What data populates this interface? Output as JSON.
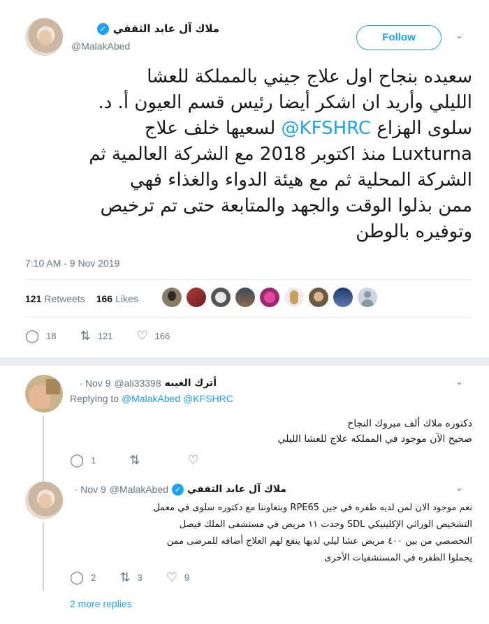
{
  "main_tweet": {
    "display_name": "ملاك آل عابد الثقفي",
    "handle": "@MalakAbed",
    "follow_label": "Follow",
    "text_lines": [
      "سعيده بنجاح اول علاج جيني بالمملكة للعشا",
      "الليلي وأريد ان اشكر أيضا رئيس قسم العيون  أ. د.",
      "سلوى الهزاع",
      "@KFSHRC",
      "لسعيها خلف علاج",
      "Luxturna منذ اكتوبر 2018 مع الشركة العالمية ثم",
      "الشركة المحلية ثم مع هيئة الدواء والغذاء فهي",
      "ممن بذلوا الوقت والجهد والمتابعة حتى تم ترخيص",
      "وتوفيره بالوطن"
    ],
    "timestamp": "7:10 AM - 9 Nov 2019",
    "retweets_count": "121",
    "retweets_label": "Retweets",
    "likes_count": "166",
    "likes_label": "Likes",
    "action_counts": {
      "reply": "18",
      "retweet": "121",
      "like": "166"
    }
  },
  "replies": [
    {
      "display_name": "أترك الغيبه",
      "handle": "@ali33398",
      "date": "Nov 9",
      "replying_prefix": "Replying to",
      "replying_to": "@MalakAbed @KFSHRC",
      "text_lines": [
        "دكتوره ملاك ألف مبروك النجاح",
        "صحيح الآن موجود في المملكه علاج للعشا الليلي"
      ],
      "counts": {
        "reply": "1",
        "retweet": "",
        "like": ""
      }
    },
    {
      "display_name": "ملاك آل عابد الثقفي",
      "handle": "@MalakAbed",
      "date": "Nov 9",
      "text_lines": [
        "نعم موجود الان  لمن لديه طفره في جين RPE65 وبتعاوننا مع دكتوره سلوى في معمل",
        "التشخيص الوراثي الإكلينيكي SDL وجدت ١١ مريض في مستشفى الملك فيصل",
        "التخصصي من بين ٤٠٠ مريض عشا ليلي لديها ينفع لهم العلاج أضافه للمرضى ممن",
        "يحملوا الطفره في المستشفيات الأخرى"
      ],
      "counts": {
        "reply": "2",
        "retweet": "3",
        "like": "9"
      }
    }
  ],
  "more_replies_label": "2 more replies",
  "icons": {
    "verified": "verified-badge-icon",
    "reply": "reply-icon",
    "retweet": "retweet-icon",
    "like": "heart-icon",
    "caret": "chevron-down-icon"
  },
  "colors": {
    "accent": "#1da1f2",
    "text": "#14171a",
    "muted": "#657786",
    "divider": "#e6ecf0"
  }
}
